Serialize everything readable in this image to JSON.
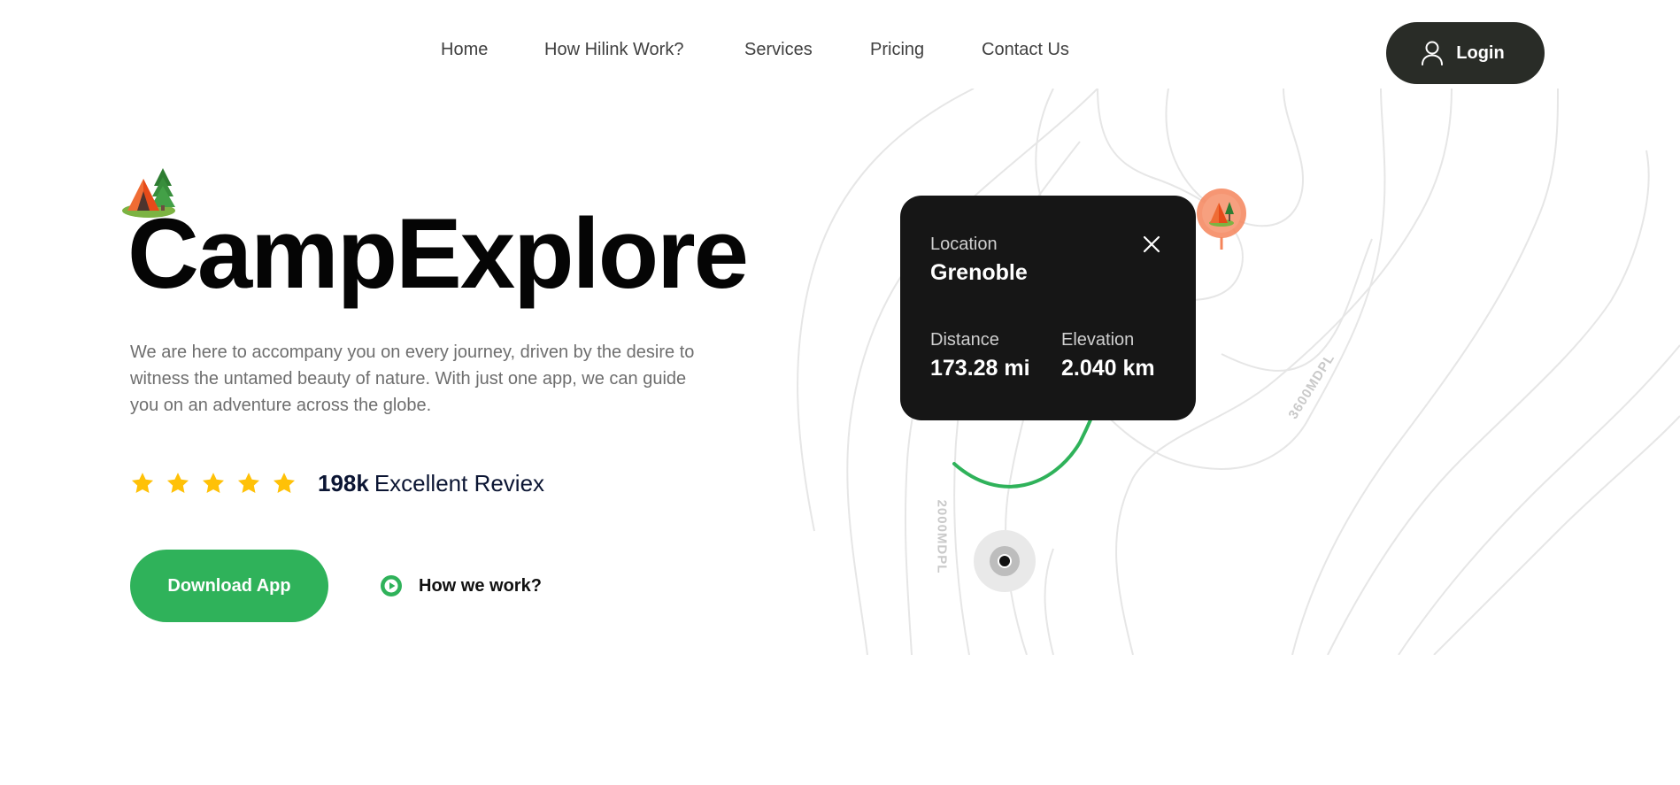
{
  "nav": {
    "links": [
      {
        "label": "Home"
      },
      {
        "label": "How Hilink Work?"
      },
      {
        "label": "Services"
      },
      {
        "label": "Pricing"
      },
      {
        "label": "Contact Us"
      }
    ],
    "login_label": "Login"
  },
  "hero": {
    "title": "CampExplore",
    "description": "We are here to accompany you on every journey, driven by the desire to witness the untamed beauty of nature. With just one app, we can guide you on an adventure across the globe.",
    "rating": {
      "stars": 5,
      "count": "198k",
      "text": "Excellent Reviex"
    },
    "download_label": "Download App",
    "how_label": "How we work?"
  },
  "map": {
    "alt_labels": [
      "3600MDPL",
      "2000MDPL"
    ],
    "card": {
      "location_label": "Location",
      "location_value": "Grenoble",
      "distance_label": "Distance",
      "distance_value": "173.28 mi",
      "elevation_label": "Elevation",
      "elevation_value": "2.040 km"
    }
  },
  "colors": {
    "primary_green": "#2fb25a",
    "dark": "#292c27",
    "card_bg": "#161616",
    "star": "#ffc107",
    "pin": "#f5845a",
    "route": "#2fb25a"
  },
  "icons": {
    "user": "user-icon",
    "star": "star-icon",
    "play": "play-icon",
    "close": "close-icon",
    "camp": "camp-tent-icon"
  }
}
